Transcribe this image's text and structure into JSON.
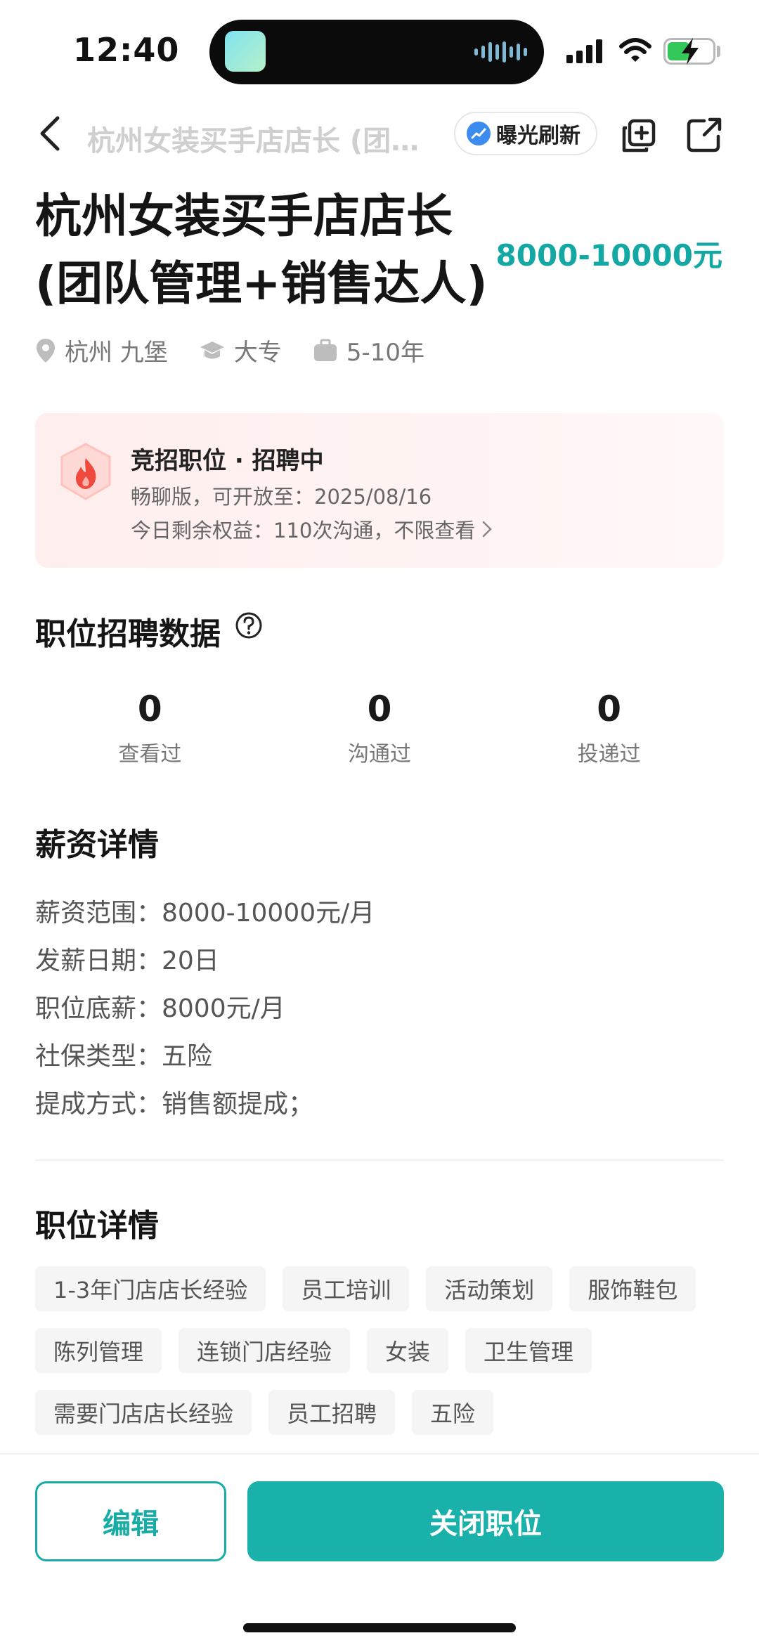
{
  "status_bar": {
    "time": "12:40",
    "battery_level": 0.5,
    "battery_color": "#34c759"
  },
  "nav": {
    "title": "杭州女装买手店店长 (团队管理+销售达人)",
    "refresh_label": "曝光刷新"
  },
  "job": {
    "title": "杭州女装买手店店长(团队管理+销售达人)",
    "salary": "8000-10000元",
    "location": "杭州 九堡",
    "education": "大专",
    "experience": "5-10年"
  },
  "promo": {
    "title": "竞招职位 · 招聘中",
    "line1": "畅聊版，可开放至：2025/08/16",
    "line2": "今日剩余权益：110次沟通，不限查看"
  },
  "stats_section": {
    "title": "职位招聘数据",
    "items": [
      {
        "value": "0",
        "label": "查看过"
      },
      {
        "value": "0",
        "label": "沟通过"
      },
      {
        "value": "0",
        "label": "投递过"
      }
    ]
  },
  "salary_section": {
    "title": "薪资详情",
    "rows": [
      "薪资范围：8000-10000元/月",
      "发薪日期：20日",
      "职位底薪：8000元/月",
      "社保类型：五险",
      "提成方式：销售额提成；"
    ]
  },
  "detail_section": {
    "title": "职位详情",
    "tags": [
      "1-3年门店店长经验",
      "员工培训",
      "活动策划",
      "服饰鞋包",
      "陈列管理",
      "连锁门店经验",
      "女装",
      "卫生管理",
      "需要门店店长经验",
      "员工招聘",
      "五险"
    ]
  },
  "actions": {
    "edit": "编辑",
    "close": "关闭职位"
  },
  "colors": {
    "accent": "#1ab1ab",
    "salary": "#13a8a3",
    "promo_bg": "#ffeeee"
  }
}
